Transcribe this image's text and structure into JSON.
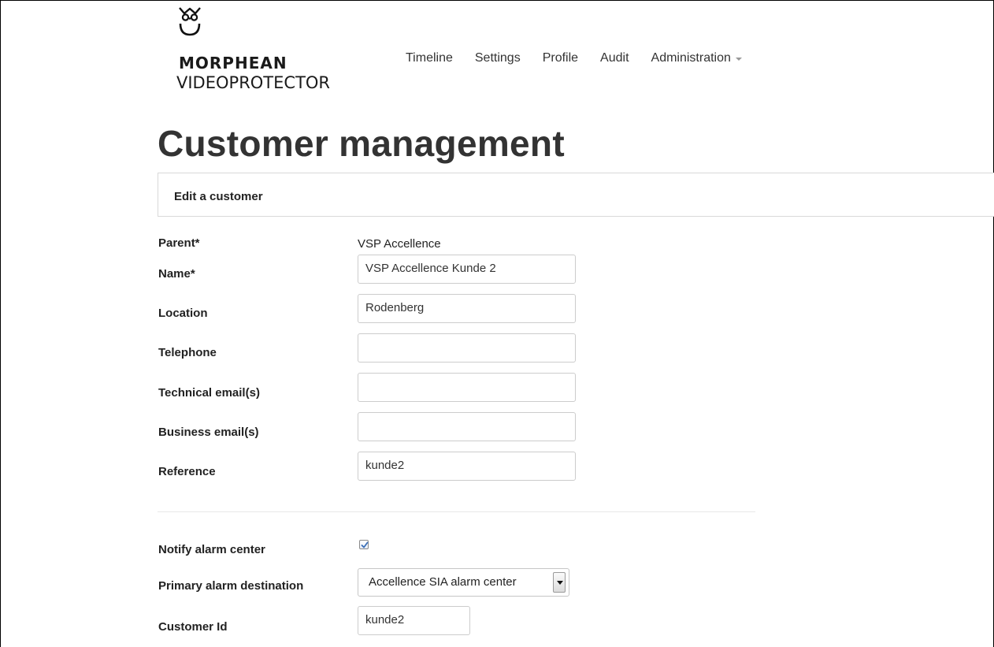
{
  "brand": {
    "line1": "MORPHEAN",
    "line2": "VIDEOPROTECTOR",
    "logo_icon": "owl-icon"
  },
  "nav": {
    "items": [
      {
        "label": "Timeline"
      },
      {
        "label": "Settings"
      },
      {
        "label": "Profile"
      },
      {
        "label": "Audit"
      },
      {
        "label": "Administration",
        "has_dropdown": true
      }
    ]
  },
  "page": {
    "title": "Customer management",
    "panel_title": "Edit a customer"
  },
  "form": {
    "parent": {
      "label": "Parent*",
      "value": "VSP Accellence"
    },
    "name": {
      "label": "Name*",
      "value": "VSP Accellence Kunde 2"
    },
    "location": {
      "label": "Location",
      "value": "Rodenberg"
    },
    "telephone": {
      "label": "Telephone",
      "value": ""
    },
    "technical_email": {
      "label": "Technical email(s)",
      "value": ""
    },
    "business_email": {
      "label": "Business email(s)",
      "value": ""
    },
    "reference": {
      "label": "Reference",
      "value": "kunde2"
    },
    "notify_alarm_center": {
      "label": "Notify alarm center",
      "checked": true
    },
    "primary_alarm_destination": {
      "label": "Primary alarm destination",
      "selected": "Accellence SIA alarm center"
    },
    "customer_id": {
      "label": "Customer Id",
      "value": "kunde2"
    }
  },
  "colors": {
    "text": "#333333",
    "border": "#cccccc",
    "checkbox_check": "#3b6fb6"
  }
}
